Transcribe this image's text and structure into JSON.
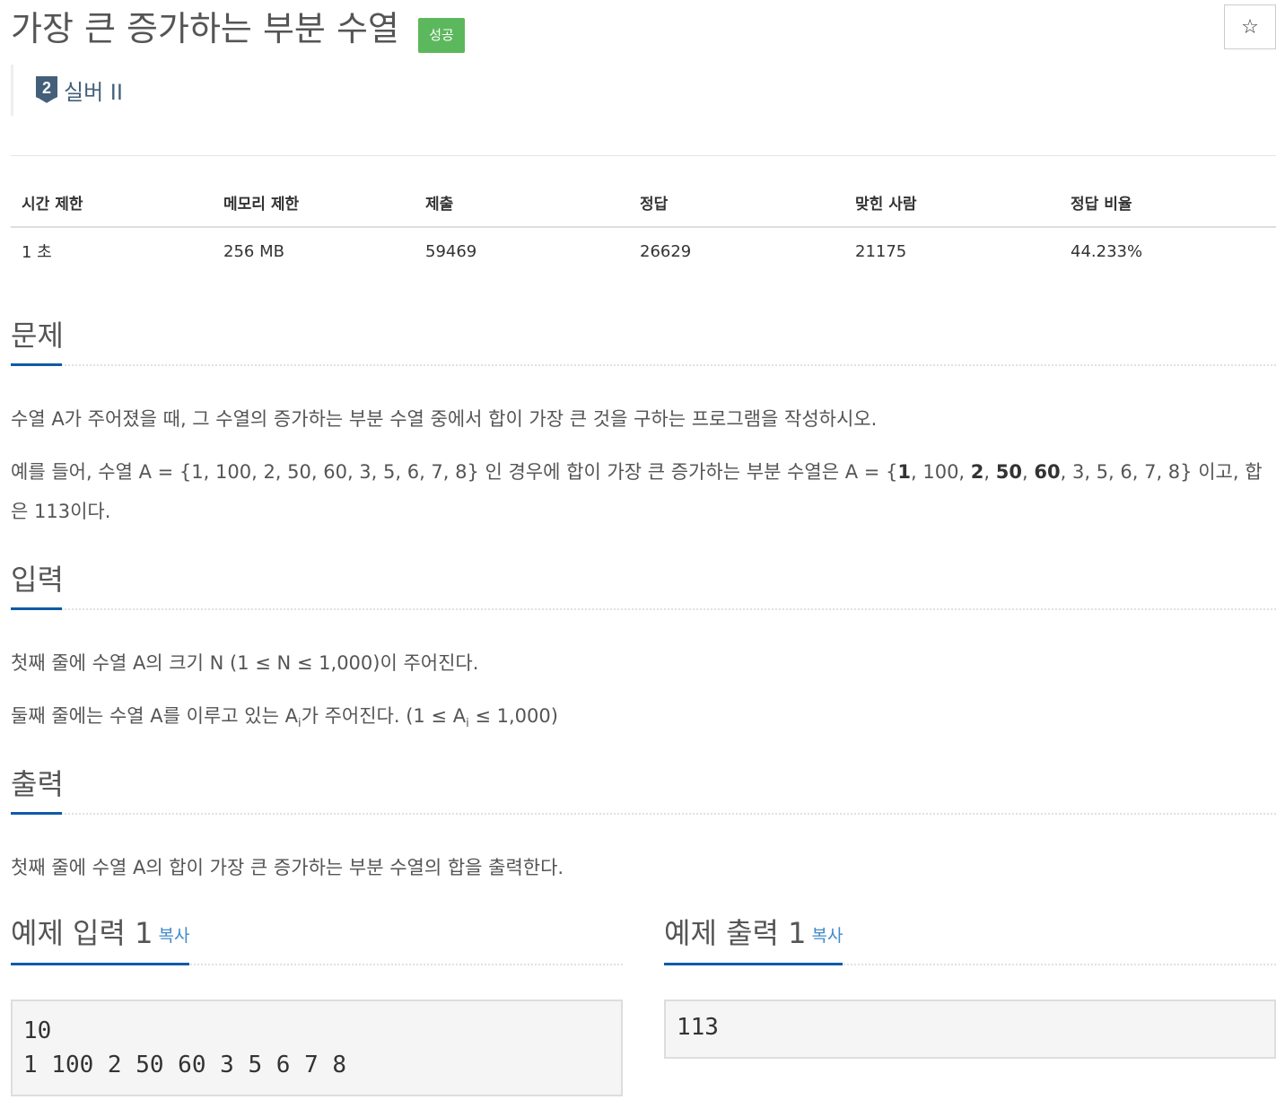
{
  "problem": {
    "title": "가장 큰 증가하는 부분 수열",
    "status_badge": "성공",
    "favorite_icon": "☆",
    "tier": {
      "number": "2",
      "label": "실버 II",
      "icon": "silver-tier-icon",
      "color": "#435f7a"
    }
  },
  "info_table": {
    "headers": [
      "시간 제한",
      "메모리 제한",
      "제출",
      "정답",
      "맞힌 사람",
      "정답 비율"
    ],
    "values": [
      "1 초",
      "256 MB",
      "59469",
      "26629",
      "21175",
      "44.233%"
    ]
  },
  "sections": {
    "description": {
      "title": "문제",
      "line1": "수열 A가 주어졌을 때, 그 수열의 증가하는 부분 수열 중에서 합이 가장 큰 것을 구하는 프로그램을 작성하시오.",
      "example_prefix": "예를 들어, 수열 A = {1, 100, 2, 50, 60, 3, 5, 6, 7, 8} 인 경우에 합이 가장 큰 증가하는 부분 수열은 A = {",
      "b1": "1",
      "s1": ", 100, ",
      "b2": "2",
      "s2": ", ",
      "b3": "50",
      "s3": ", ",
      "b4": "60",
      "s4": ", 3, 5, 6, 7, 8} 이고, 합은 113이다."
    },
    "input": {
      "title": "입력",
      "line1": "첫째 줄에 수열 A의 크기 N (1 ≤ N ≤ 1,000)이 주어진다.",
      "line2_a": "둘째 줄에는 수열 A를 이루고 있는 A",
      "line2_sub": "i",
      "line2_b": "가 주어진다. (1 ≤ A",
      "line2_sub2": "i",
      "line2_c": " ≤ 1,000)"
    },
    "output": {
      "title": "출력",
      "line1": "첫째 줄에 수열 A의 합이 가장 큰 증가하는 부분 수열의 합을 출력한다."
    }
  },
  "samples": {
    "input": {
      "title": "예제 입력 1",
      "copy_label": "복사",
      "content": "10\n1 100 2 50 60 3 5 6 7 8"
    },
    "output": {
      "title": "예제 출력 1",
      "copy_label": "복사",
      "content": "113"
    }
  },
  "colors": {
    "success": "#5cb85c",
    "accent_underline": "#0f5aa8",
    "link": "#428bca"
  }
}
